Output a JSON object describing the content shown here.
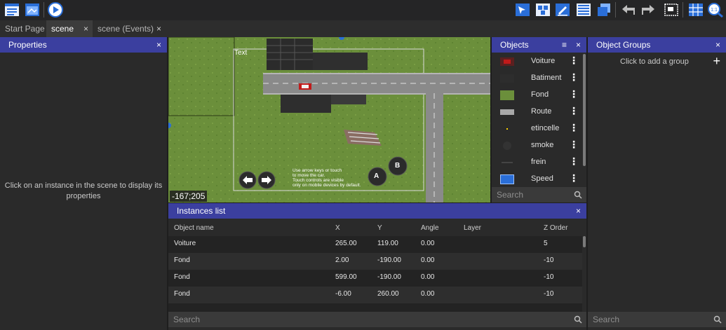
{
  "tabs": [
    {
      "label": "Start Page"
    },
    {
      "label": "scene",
      "close": "×"
    },
    {
      "label": "scene (Events)",
      "close": "×"
    }
  ],
  "properties": {
    "title": "Properties",
    "close": "×",
    "message_line1": "Click on an instance in the scene to display its",
    "message_line2": "properties"
  },
  "scene": {
    "text_label": "Text",
    "hint_line1": "Use arrow keys or touch",
    "hint_line2": "to move the car.",
    "hint_line3": "Touch controls are visible",
    "hint_line4": "only on mobile devices by default.",
    "button_a": "A",
    "button_b": "B",
    "coords": "-167;205"
  },
  "objects": {
    "title": "Objects",
    "close": "×",
    "search_placeholder": "Search",
    "items": [
      {
        "label": "Voiture",
        "icon": "car-thumb-icon"
      },
      {
        "label": "Batiment",
        "icon": "building-thumb-icon"
      },
      {
        "label": "Fond",
        "icon": "grass-thumb-icon"
      },
      {
        "label": "Route",
        "icon": "road-thumb-icon"
      },
      {
        "label": "etincelle",
        "icon": "spark-thumb-icon"
      },
      {
        "label": "smoke",
        "icon": "smoke-thumb-icon"
      },
      {
        "label": "frein",
        "icon": "brake-thumb-icon"
      },
      {
        "label": "Speed",
        "icon": "speed-thumb-icon"
      }
    ]
  },
  "groups": {
    "title": "Object Groups",
    "close": "×",
    "message": "Click to add a group",
    "add": "+",
    "search_placeholder": "Search"
  },
  "instances": {
    "title": "Instances list",
    "close": "×",
    "search_placeholder": "Search",
    "columns": [
      "Object name",
      "X",
      "Y",
      "Angle",
      "Layer",
      "Z Order"
    ],
    "rows": [
      [
        "Voiture",
        "265.00",
        "119.00",
        "0.00",
        "",
        "5"
      ],
      [
        "Fond",
        "2.00",
        "-190.00",
        "0.00",
        "",
        "-10"
      ],
      [
        "Fond",
        "599.00",
        "-190.00",
        "0.00",
        "",
        "-10"
      ],
      [
        "Fond",
        "-6.00",
        "260.00",
        "0.00",
        "",
        "-10"
      ]
    ]
  },
  "colors": {
    "panel_header": "#3b3f9f",
    "accent": "#2a6ed8"
  }
}
